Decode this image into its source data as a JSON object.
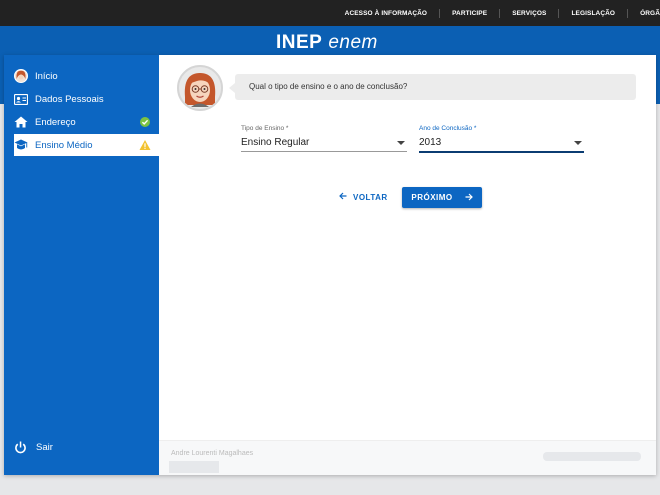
{
  "govbar": {
    "links": [
      "ACESSO À INFORMAÇÃO",
      "PARTICIPE",
      "SERVIÇOS",
      "LEGISLAÇÃO",
      "ÓRGÃ"
    ]
  },
  "brand": {
    "inep": "INEP",
    "enem": "enem"
  },
  "sidebar": {
    "items": [
      {
        "label": "Início",
        "icon": "person-avatar-icon"
      },
      {
        "label": "Dados Pessoais",
        "icon": "id-card-icon"
      },
      {
        "label": "Endereço",
        "icon": "home-icon",
        "status": "check-circle-icon"
      },
      {
        "label": "Ensino Médio",
        "icon": "graduation-cap-icon",
        "status": "warning-icon",
        "active": true
      }
    ],
    "logout_label": "Sair"
  },
  "main": {
    "question": "Qual o tipo de ensino e o ano de conclusão?",
    "tipo_ensino": {
      "label": "Tipo de Ensino *",
      "value": "Ensino Regular"
    },
    "ano_conclusao": {
      "label": "Ano de Conclusão *",
      "value": "2013"
    },
    "back_label": "VOLTAR",
    "next_label": "PRÓXIMO"
  },
  "footer": {
    "user_name": "Andre Lourenti Magalhaes"
  },
  "colors": {
    "primary": "#0c66c2",
    "header": "#0b5fb3",
    "success": "#7cc242",
    "warning": "#f2c230"
  }
}
